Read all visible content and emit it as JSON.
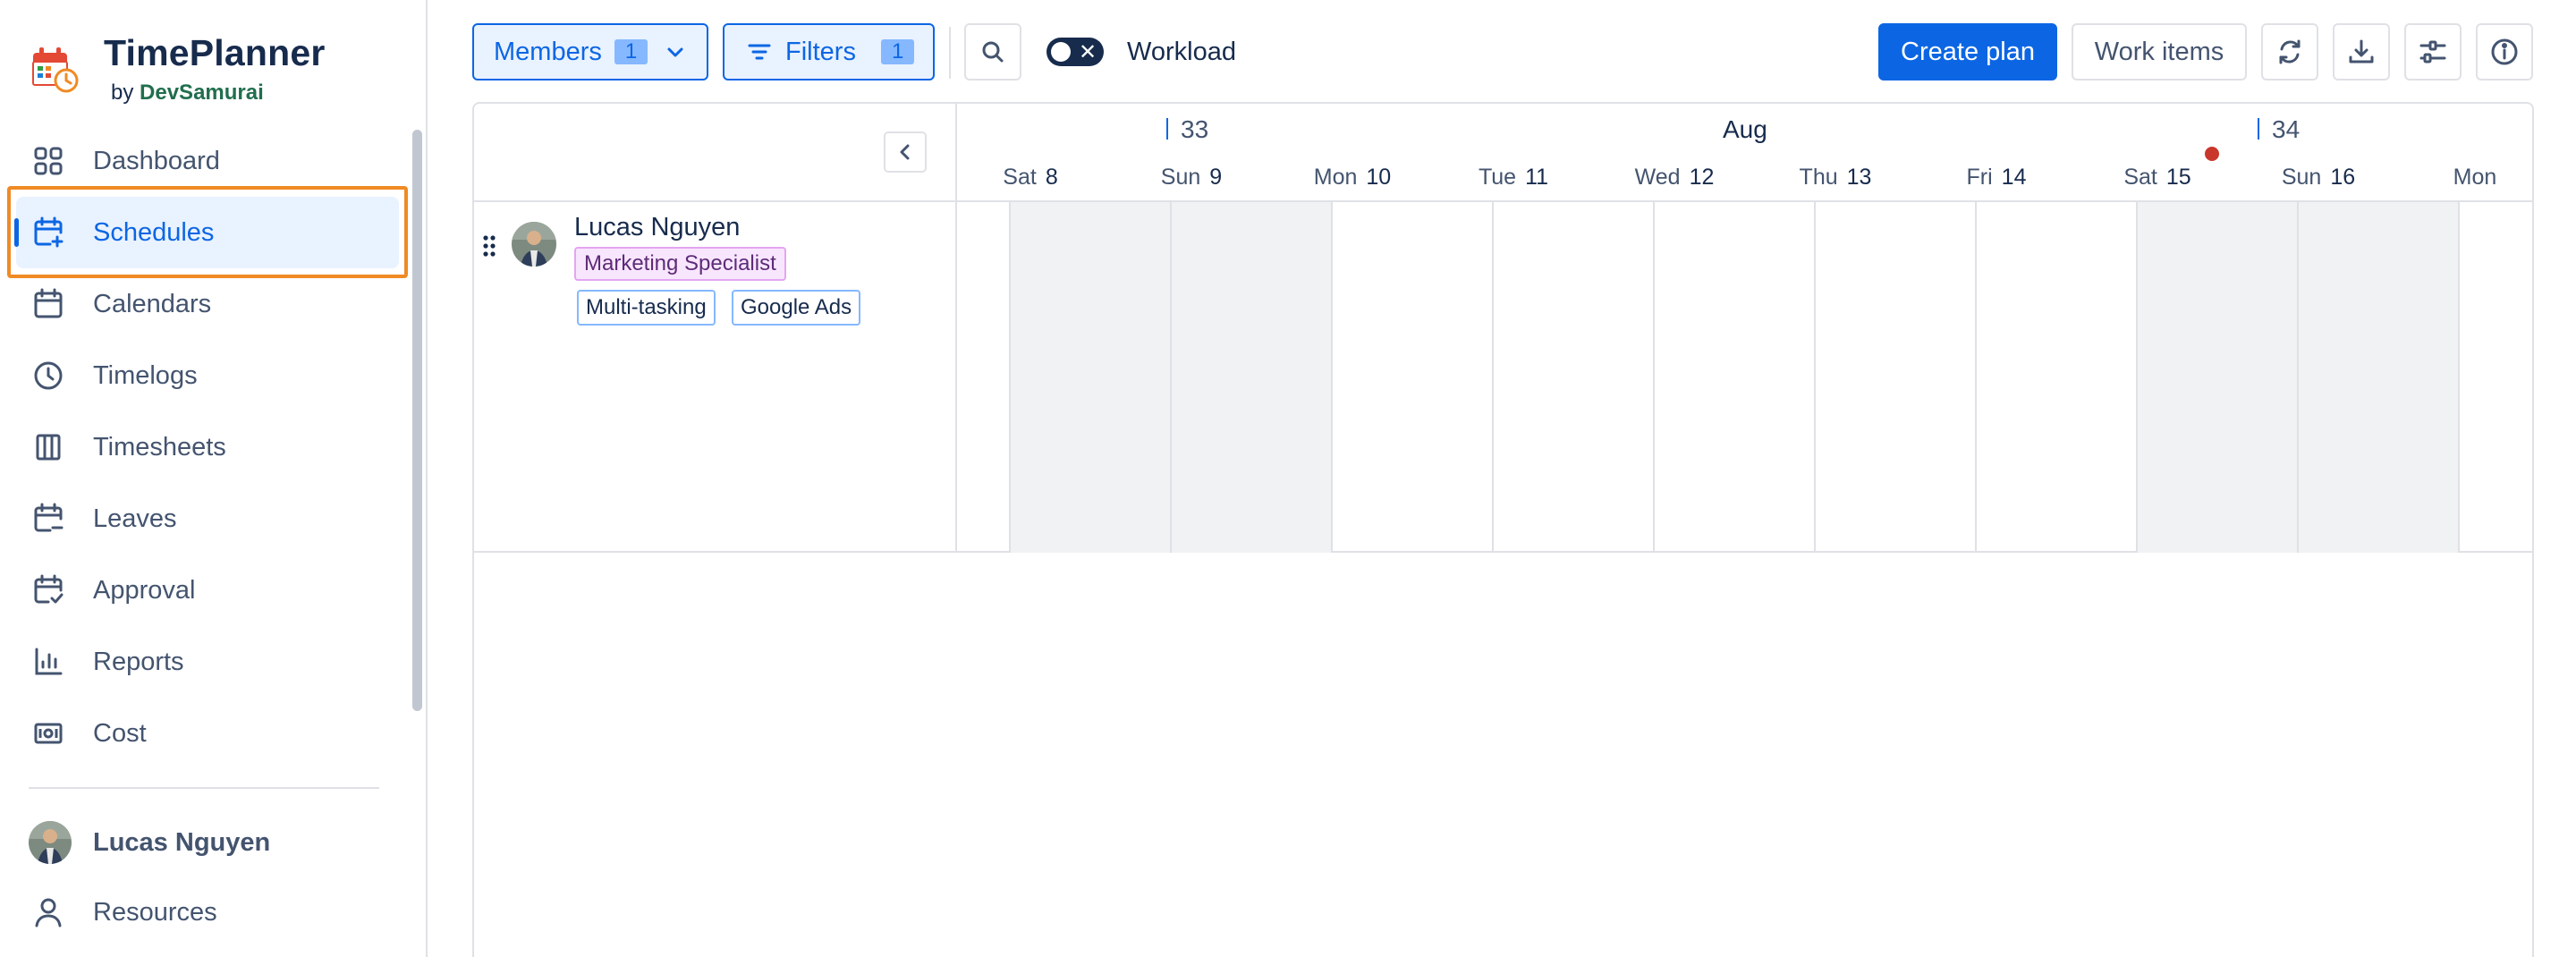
{
  "brand": {
    "title": "TimePlanner",
    "by": "by",
    "vendor": "DevSamurai"
  },
  "sidebar": {
    "items": [
      {
        "label": "Dashboard",
        "icon": "dashboard-grid-icon",
        "active": false
      },
      {
        "label": "Schedules",
        "icon": "calendar-plus-icon",
        "active": true
      },
      {
        "label": "Calendars",
        "icon": "calendar-icon",
        "active": false
      },
      {
        "label": "Timelogs",
        "icon": "clock-icon",
        "active": false
      },
      {
        "label": "Timesheets",
        "icon": "timesheet-columns-icon",
        "active": false
      },
      {
        "label": "Leaves",
        "icon": "calendar-minus-icon",
        "active": false
      },
      {
        "label": "Approval",
        "icon": "calendar-check-icon",
        "active": false
      },
      {
        "label": "Reports",
        "icon": "bar-chart-icon",
        "active": false
      },
      {
        "label": "Cost",
        "icon": "money-icon",
        "active": false
      }
    ],
    "user": {
      "name": "Lucas Nguyen"
    },
    "resources_label": "Resources"
  },
  "toolbar": {
    "members_label": "Members",
    "members_count": "1",
    "filters_label": "Filters",
    "filters_count": "1",
    "workload_label": "Workload",
    "workload_on": false,
    "create_plan_label": "Create plan",
    "work_items_label": "Work items",
    "accent_color": "#0c66e4"
  },
  "timeline": {
    "week_33": "33",
    "week_34": "34",
    "month": "Aug",
    "days": [
      {
        "dow": "Sat",
        "day": "8",
        "weekend": true
      },
      {
        "dow": "Sun",
        "day": "9",
        "weekend": true
      },
      {
        "dow": "Mon",
        "day": "10",
        "weekend": false
      },
      {
        "dow": "Tue",
        "day": "11",
        "weekend": false
      },
      {
        "dow": "Wed",
        "day": "12",
        "weekend": false
      },
      {
        "dow": "Thu",
        "day": "13",
        "weekend": false
      },
      {
        "dow": "Fri",
        "day": "14",
        "weekend": false
      },
      {
        "dow": "Sat",
        "day": "15",
        "weekend": true
      },
      {
        "dow": "Sun",
        "day": "16",
        "weekend": true
      },
      {
        "dow": "Mon",
        "day": "",
        "weekend": false
      }
    ],
    "today_color": "#c9372c"
  },
  "members": [
    {
      "name": "Lucas Nguyen",
      "role": "Marketing Specialist",
      "skills": [
        "Multi-tasking",
        "Google Ads"
      ]
    }
  ]
}
